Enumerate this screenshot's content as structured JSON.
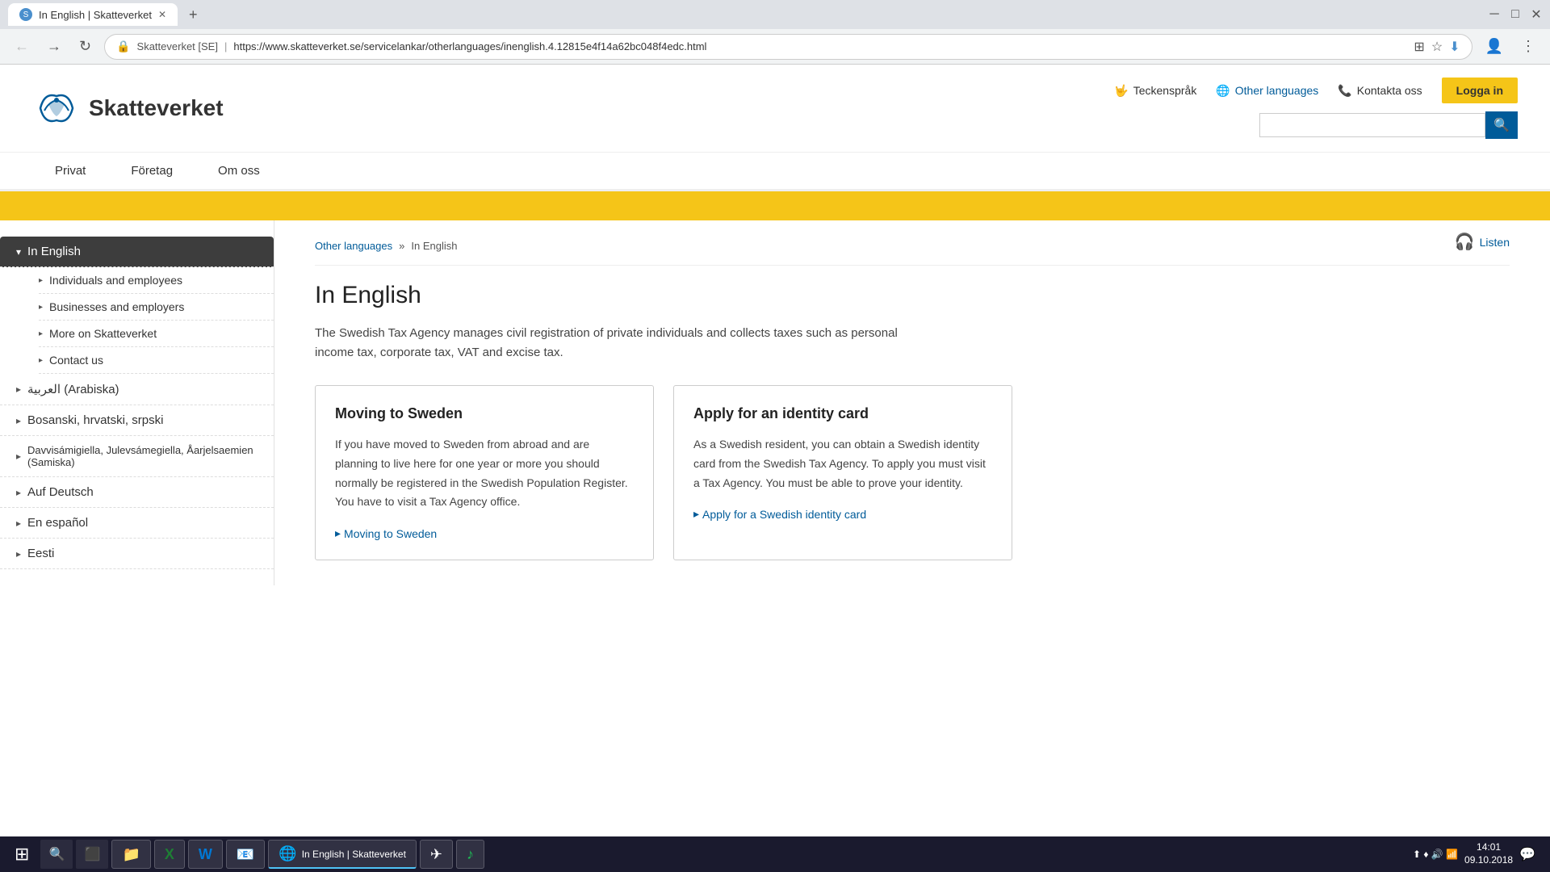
{
  "browser": {
    "tab_title": "In English | Skatteverket",
    "tab_favicon": "S",
    "url": "https://www.skatteverket.se/servicelankar/otherlanguages/inenglish.4.12815e4f14a62bc048f4edc.html",
    "new_tab_label": "+",
    "nav": {
      "back": "←",
      "forward": "→",
      "reload": "↺",
      "home": "⌂"
    },
    "address_bar_icons": [
      "🌐",
      "☆",
      "⬇",
      "👤",
      "⋮"
    ],
    "site_label": "Skatteverket [SE]"
  },
  "header": {
    "logo_text": "Skatteverket",
    "links": [
      {
        "icon": "🤟",
        "label": "Teckenspråk",
        "active": false
      },
      {
        "icon": "🌐",
        "label": "Other languages",
        "active": true
      },
      {
        "icon": "📞",
        "label": "Kontakta oss",
        "active": false
      }
    ],
    "login_button": "Logga in",
    "search_placeholder": ""
  },
  "nav": {
    "items": [
      {
        "label": "Privat"
      },
      {
        "label": "Företag"
      },
      {
        "label": "Om oss"
      }
    ]
  },
  "breadcrumb": {
    "parent": "Other languages",
    "separator": "»",
    "current": "In English"
  },
  "listen_button": "Listen",
  "page": {
    "title": "In English",
    "description": "The Swedish Tax Agency manages civil registration of private individuals and collects taxes such as personal income tax, corporate tax, VAT and excise tax."
  },
  "sidebar": {
    "active_item": {
      "label": "In English",
      "arrow": "▾"
    },
    "sub_items": [
      {
        "label": "Individuals and employees"
      },
      {
        "label": "Businesses and employers"
      },
      {
        "label": "More on Skatteverket"
      },
      {
        "label": "Contact us"
      }
    ],
    "other_items": [
      {
        "label": "العربية (Arabiska)",
        "arrow": "▸"
      },
      {
        "label": "Bosanski, hrvatski, srpski",
        "arrow": "▸"
      },
      {
        "label": "Davvisámigiella, Julevsámegiella, Åarjelsaemien (Samiska)",
        "arrow": "▸"
      },
      {
        "label": "Auf Deutsch",
        "arrow": "▸"
      },
      {
        "label": "En español",
        "arrow": "▸"
      },
      {
        "label": "Eesti",
        "arrow": "▸"
      }
    ]
  },
  "cards": [
    {
      "title": "Moving to Sweden",
      "text": "If you have moved to Sweden from abroad and are planning to live here for one year or more you should normally be registered in the Swedish Population Register. You have to visit a Tax Agency office.",
      "link_label": "Moving to Sweden",
      "link_arrow": "▸"
    },
    {
      "title": "Apply for an identity card",
      "text": "As a Swedish resident, you can obtain a Swedish identity card from the Swedish Tax Agency. To apply you must visit a Tax Agency. You must be able to prove your identity.",
      "link_label": "Apply for a Swedish identity card",
      "link_arrow": "▸"
    }
  ],
  "taskbar": {
    "apps": [
      {
        "icon": "⊞",
        "label": "",
        "type": "start"
      },
      {
        "icon": "📁",
        "label": ""
      },
      {
        "icon": "📊",
        "label": ""
      },
      {
        "icon": "W",
        "label": ""
      },
      {
        "icon": "📧",
        "label": ""
      },
      {
        "icon": "🌐",
        "label": "In English | Skatteverket",
        "active": true
      },
      {
        "icon": "✈",
        "label": ""
      },
      {
        "icon": "♪",
        "label": ""
      }
    ],
    "tray": {
      "time": "14:01",
      "date": "09.10.2018"
    }
  }
}
